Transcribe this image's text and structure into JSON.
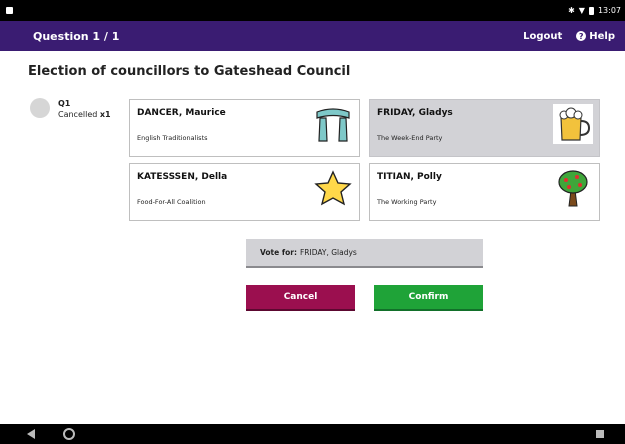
{
  "status_bar": {
    "time": "13:07",
    "icons": [
      "bluetooth-icon",
      "wifi-icon",
      "battery-icon"
    ]
  },
  "app_bar": {
    "title": "Question 1 / 1",
    "logout_label": "Logout",
    "help_label": "Help"
  },
  "election": {
    "title": "Election of councillors to Gateshead Council"
  },
  "question_marker": {
    "label": "Q1",
    "cancelled_text": "Cancelled",
    "cancelled_count": "x1"
  },
  "candidates": [
    {
      "name": "DANCER, Maurice",
      "party": "English Traditionalists",
      "logo": "stonehenge-icon",
      "selected": false
    },
    {
      "name": "FRIDAY, Gladys",
      "party": "The Week-End Party",
      "logo": "beer-mug-icon",
      "selected": true
    },
    {
      "name": "KATESSSEN, Della",
      "party": "Food-For-All Coalition",
      "logo": "star-icon",
      "selected": false
    },
    {
      "name": "TITIAN, Polly",
      "party": "The Working Party",
      "logo": "tree-icon",
      "selected": false
    }
  ],
  "vote_summary": {
    "label": "Vote for:",
    "value": "FRIDAY, Gladys"
  },
  "buttons": {
    "cancel_label": "Cancel",
    "confirm_label": "Confirm"
  },
  "colors": {
    "app_bar": "#3a1c72",
    "cancel": "#9b0f4f",
    "confirm": "#1fa338",
    "selected_card": "#d2d2d6"
  }
}
